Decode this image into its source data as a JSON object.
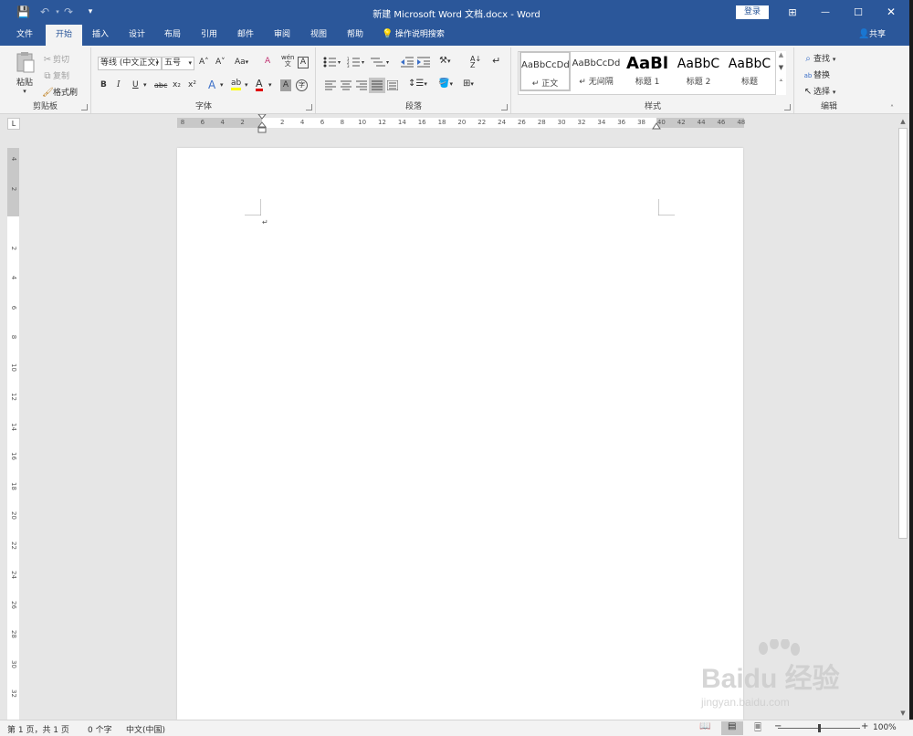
{
  "titlebar": {
    "title": "新建 Microsoft Word 文档.docx  -  Word",
    "login_label": "登录",
    "minimize": "—",
    "maximize": "☐",
    "close": "✕",
    "ribbon_display": "⊞",
    "qat_save": "💾",
    "qat_undo": "↶",
    "qat_redo": "↷",
    "qat_customize": "▾"
  },
  "tabs": [
    "文件",
    "开始",
    "插入",
    "设计",
    "布局",
    "引用",
    "邮件",
    "审阅",
    "视图",
    "帮助"
  ],
  "tell_me": "操作说明搜索",
  "share": "共享",
  "clipboard": {
    "label": "剪贴板",
    "paste": "粘贴",
    "cut": "剪切",
    "copy": "复制",
    "format_painter": "格式刷"
  },
  "font": {
    "label": "字体",
    "font_name": "等线 (中文正文)",
    "font_size": "五号",
    "grow": "A˄",
    "shrink": "A˅",
    "change_case": "Aa",
    "clear": "A",
    "phonetic": "wén",
    "border": "A",
    "bold": "B",
    "italic": "I",
    "underline": "U",
    "strike": "abc",
    "sub": "x₂",
    "sup": "x²",
    "effects": "A",
    "highlight": "ab",
    "color": "A",
    "shading": "A",
    "enclose": "字"
  },
  "paragraph": {
    "label": "段落"
  },
  "styles": {
    "label": "样式",
    "items": [
      {
        "sample": "AaBbCcDd",
        "name": "↵ 正文"
      },
      {
        "sample": "AaBbCcDd",
        "name": "↵ 无间隔"
      },
      {
        "sample": "AaBl",
        "name": "标题 1"
      },
      {
        "sample": "AaBbC",
        "name": "标题 2"
      },
      {
        "sample": "AaBbC",
        "name": "标题"
      }
    ]
  },
  "editing": {
    "label": "编辑",
    "find": "查找",
    "replace": "替换",
    "select": "选择"
  },
  "ruler": {
    "h_ticks": [
      "8",
      "6",
      "4",
      "2",
      "",
      "2",
      "4",
      "6",
      "8",
      "10",
      "12",
      "14",
      "16",
      "18",
      "20",
      "22",
      "24",
      "26",
      "28",
      "30",
      "32",
      "34",
      "36",
      "38",
      "40",
      "42",
      "44",
      "46",
      "48"
    ],
    "v_ticks": [
      "4",
      "2",
      "",
      "2",
      "4",
      "6",
      "8",
      "10",
      "12",
      "14",
      "16",
      "18",
      "20",
      "22",
      "24",
      "26",
      "28",
      "30",
      "32"
    ]
  },
  "document": {
    "paragraph_mark": "↵"
  },
  "statusbar": {
    "page": "第 1 页，共 1 页",
    "words": "0 个字",
    "language": "中文(中国)",
    "zoom": "100%",
    "zoom_out": "−",
    "zoom_in": "+"
  },
  "watermark": {
    "main": "Baidu 经验",
    "sub": "jingyan.baidu.com"
  },
  "colors": {
    "titlebar": "#2b579a",
    "ribbon": "#f3f3f3",
    "highlight_yellow": "#ffff00",
    "font_red": "#e00000"
  }
}
